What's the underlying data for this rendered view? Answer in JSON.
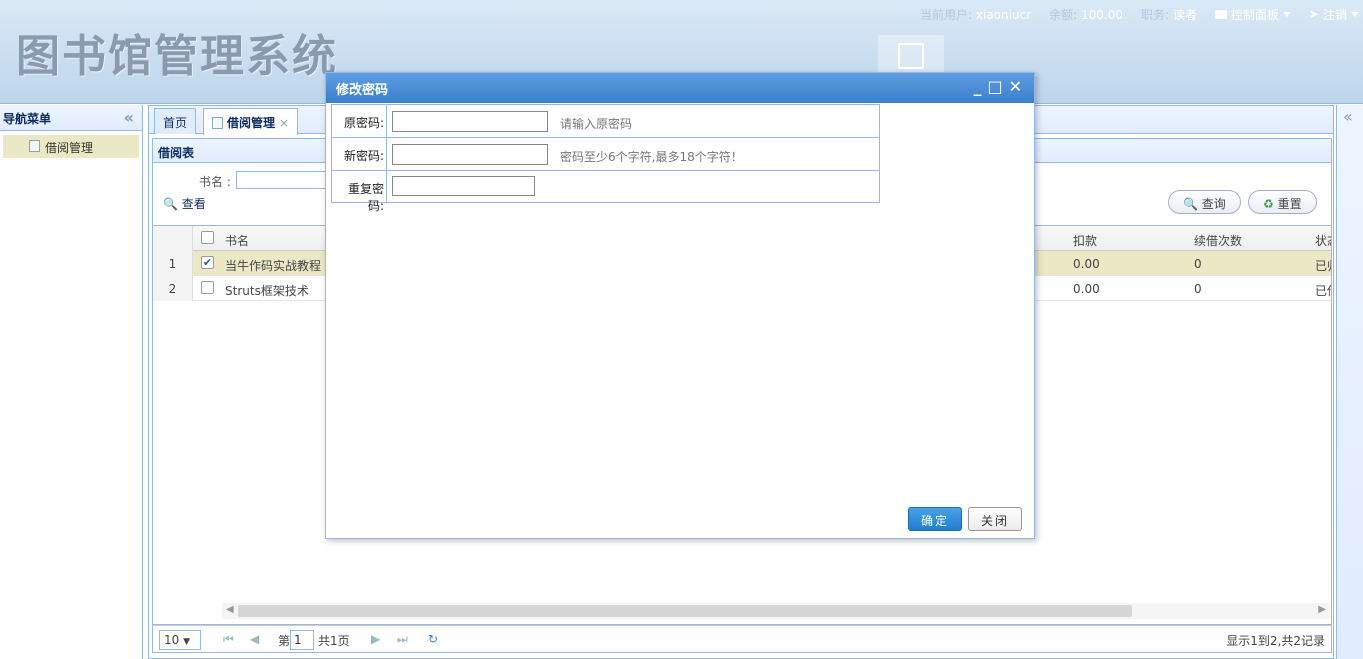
{
  "app": {
    "title": "图书馆管理系统"
  },
  "topbar": {
    "user_label": "当前用户:",
    "user_value": "xiaoniucr",
    "balance_label": "余额:",
    "balance_value": "100.00",
    "role_label": "职务:",
    "role_value": "读者",
    "control_panel": "控制面板",
    "logout": "注销"
  },
  "nav": {
    "title": "导航菜单",
    "items": [
      {
        "label": "借阅管理"
      }
    ]
  },
  "tabs": [
    {
      "label": "首页"
    },
    {
      "label": "借阅管理",
      "close": "×"
    }
  ],
  "panel": {
    "title": "借阅表",
    "search_label": "书名 :",
    "view_label": "查看",
    "query_button": "查询",
    "reset_button": "重置"
  },
  "grid": {
    "columns": [
      "书名",
      "扣款",
      "续借次数",
      "状态"
    ],
    "rows": [
      {
        "num": "1",
        "checked": true,
        "title": "当牛作码实战教程",
        "fine": "0.00",
        "renew": "0",
        "status": "已归"
      },
      {
        "num": "2",
        "checked": false,
        "title": "Struts框架技术",
        "fine": "0.00",
        "renew": "0",
        "status": "已借"
      }
    ]
  },
  "pager": {
    "page_size": "10",
    "page_prefix": "第",
    "page_value": "1",
    "total_pages": "共1页",
    "info": "显示1到2,共2记录"
  },
  "dialog": {
    "title": "修改密码",
    "fields": [
      {
        "label": "原密码:",
        "value": "",
        "hint": "请输入原密码"
      },
      {
        "label": "新密码:",
        "value": "",
        "hint": "密码至少6个字符,最多18个字符！"
      },
      {
        "label": "重复密码:",
        "value": "",
        "hint": ""
      }
    ],
    "ok_button": "确定",
    "close_button": "关闭"
  }
}
